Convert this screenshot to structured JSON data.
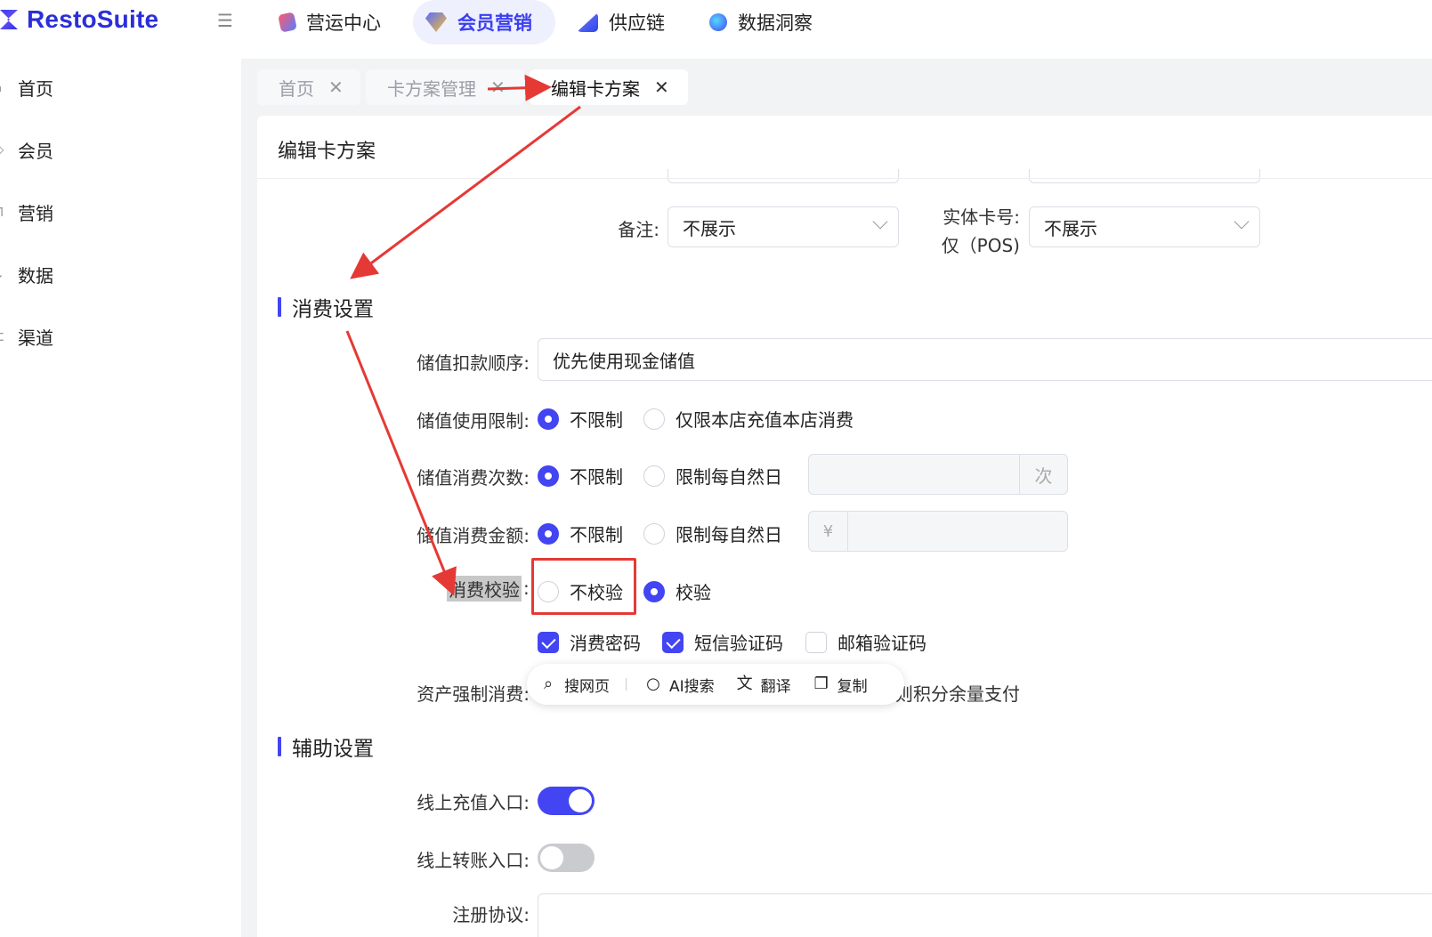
{
  "app": {
    "name": "RestoSuite"
  },
  "topnav": [
    {
      "label": "营运中心",
      "icon": "operations-icon",
      "active": false
    },
    {
      "label": "会员营销",
      "icon": "member-marketing-icon",
      "active": true
    },
    {
      "label": "供应链",
      "icon": "supply-chain-icon",
      "active": false
    },
    {
      "label": "数据洞察",
      "icon": "data-insight-icon",
      "active": false
    }
  ],
  "sidebar": {
    "items": [
      {
        "label": "首页",
        "icon": "home-icon"
      },
      {
        "label": "会员",
        "icon": "tag-icon"
      },
      {
        "label": "营销",
        "icon": "gift-icon"
      },
      {
        "label": "数据",
        "icon": "chart-icon"
      },
      {
        "label": "渠道",
        "icon": "channel-icon"
      }
    ]
  },
  "tabs": [
    {
      "label": "首页",
      "active": false
    },
    {
      "label": "卡方案管理",
      "active": false
    },
    {
      "label": "编辑卡方案",
      "active": true
    }
  ],
  "page": {
    "title": "编辑卡方案",
    "remark_label": "备注:",
    "remark_value": "不展示",
    "card_no_label_1": "实体卡号:",
    "card_no_label_2": "仅（POS)",
    "card_no_value": "不展示"
  },
  "consume": {
    "section_title": "消费设置",
    "deduct_order_label": "储值扣款顺序:",
    "deduct_order_value": "优先使用现金储值",
    "use_limit_label": "储值使用限制:",
    "use_limit_opt1": "不限制",
    "use_limit_opt2": "仅限本店充值本店消费",
    "count_label": "储值消费次数:",
    "count_opt1": "不限制",
    "count_opt2": "限制每自然日",
    "count_suffix": "次",
    "amount_label": "储值消费金额:",
    "amount_opt1": "不限制",
    "amount_opt2": "限制每自然日",
    "amount_prefix": "¥",
    "verify_label": "消费校验",
    "verify_colon": ":",
    "verify_opt1": "不校验",
    "verify_opt2": "校验",
    "verify_check1": "消费密码",
    "verify_check2": "短信验证码",
    "verify_check3": "邮箱验证码",
    "force_label": "资产强制消费:",
    "force_text_tail": "则积分余量支付"
  },
  "popup": {
    "search_web": "搜网页",
    "ai_search": "AI搜索",
    "translate": "翻译",
    "copy": "复制"
  },
  "assist": {
    "section_title": "辅助设置",
    "online_recharge_label": "线上充值入口:",
    "online_transfer_label": "线上转账入口:",
    "register_label": "注册协议:",
    "online_recharge_on": true,
    "online_transfer_on": false
  },
  "colors": {
    "accent": "#4345f2",
    "annotation": "#e53935",
    "active_nav_bg": "#eef0fd"
  }
}
